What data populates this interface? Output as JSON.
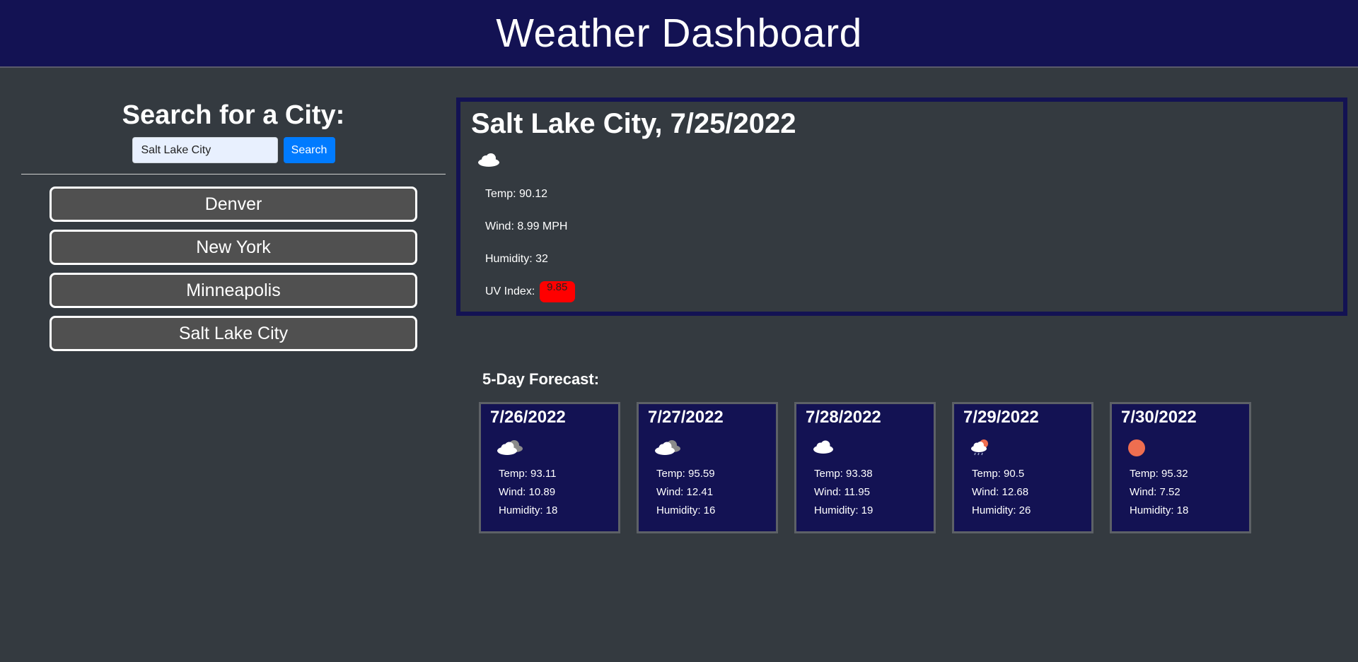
{
  "header": {
    "title": "Weather Dashboard"
  },
  "search": {
    "heading": "Search for a City:",
    "input_value": "Salt Lake City",
    "button_label": "Search"
  },
  "history": [
    "Denver",
    "New York",
    "Minneapolis",
    "Salt Lake City"
  ],
  "current": {
    "title": "Salt Lake City, 7/25/2022",
    "icon": "cloud-icon",
    "temp": "Temp: 90.12",
    "wind": "Wind: 8.99 MPH",
    "humidity": "Humidity: 32",
    "uv_label": "UV Index:",
    "uv_value": "9.85",
    "uv_color": "#ff0000"
  },
  "forecast": {
    "title": "5-Day Forecast:",
    "days": [
      {
        "date": "7/26/2022",
        "icon": "broken-clouds-icon",
        "temp": "Temp: 93.11",
        "wind": "Wind: 10.89",
        "humidity": "Humidity: 18"
      },
      {
        "date": "7/27/2022",
        "icon": "broken-clouds-icon",
        "temp": "Temp: 95.59",
        "wind": "Wind: 12.41",
        "humidity": "Humidity: 16"
      },
      {
        "date": "7/28/2022",
        "icon": "cloud-icon",
        "temp": "Temp: 93.38",
        "wind": "Wind: 11.95",
        "humidity": "Humidity: 19"
      },
      {
        "date": "7/29/2022",
        "icon": "rain-sun-icon",
        "temp": "Temp: 90.5",
        "wind": "Wind: 12.68",
        "humidity": "Humidity: 26"
      },
      {
        "date": "7/30/2022",
        "icon": "sun-icon",
        "temp": "Temp: 95.32",
        "wind": "Wind: 7.52",
        "humidity": "Humidity: 18"
      }
    ]
  },
  "colors": {
    "background": "#343a40",
    "header": "#131253",
    "accent": "#007bff",
    "sun": "#ee6e50"
  }
}
